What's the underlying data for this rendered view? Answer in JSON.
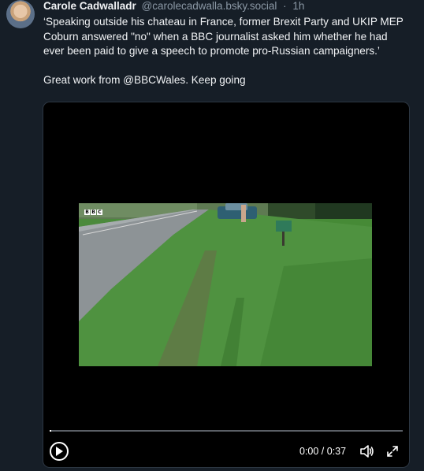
{
  "post": {
    "author": "Carole Cadwalladr",
    "handle": "@carolecadwalla.bsky.social",
    "separator": "·",
    "time": "1h",
    "paragraph1": "‘Speaking outside his chateau in France, former Brexit Party and UKIP MEP Coburn answered \"no\" when a BBC journalist asked him whether he had ever been paid to give a speech to promote pro-Russian campaigners.’",
    "paragraph2": "Great work from @BBCWales. Keep going"
  },
  "video": {
    "watermark_letters": [
      "B",
      "B",
      "C"
    ],
    "time_readout": "0:00 / 0:37",
    "progress": 0,
    "icons": {
      "play": "play-icon",
      "volume": "volume-icon",
      "fullscreen": "fullscreen-icon"
    }
  },
  "colors": {
    "background": "#161e27",
    "text": "#f1f3f5",
    "muted": "#8b98a5",
    "video_bg": "#000000"
  }
}
